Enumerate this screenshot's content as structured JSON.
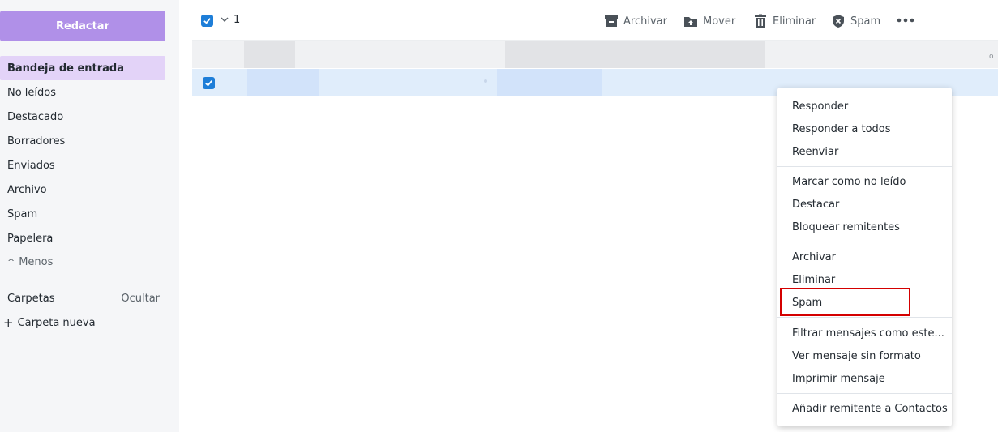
{
  "sidebar": {
    "compose_label": "Redactar",
    "nav": [
      {
        "label": "Bandeja de entrada",
        "active": true
      },
      {
        "label": "No leídos"
      },
      {
        "label": "Destacado"
      },
      {
        "label": "Borradores"
      },
      {
        "label": "Enviados"
      },
      {
        "label": "Archivo"
      },
      {
        "label": "Spam"
      },
      {
        "label": "Papelera"
      }
    ],
    "less_label": "Menos",
    "folders_label": "Carpetas",
    "folders_hide_label": "Ocultar",
    "new_folder_label": "Carpeta nueva"
  },
  "toolbar": {
    "selected_count": "1",
    "archive_label": "Archivar",
    "move_label": "Mover",
    "delete_label": "Eliminar",
    "spam_label": "Spam"
  },
  "list": {
    "row1_indicator": "o"
  },
  "context_menu": {
    "groups": [
      [
        "Responder",
        "Responder a todos",
        "Reenviar"
      ],
      [
        "Marcar como no leído",
        "Destacar",
        "Bloquear remitentes"
      ],
      [
        "Archivar",
        "Eliminar",
        "Spam"
      ],
      [
        "Filtrar mensajes como este...",
        "Ver mensaje sin formato",
        "Imprimir mensaje"
      ],
      [
        "Añadir remitente a Contactos"
      ]
    ],
    "highlighted_item": "Spam"
  },
  "colors": {
    "compose": "#b090e8",
    "active_nav": "#e3d3f8",
    "selected_row": "#e0edfb",
    "checkbox": "#1e7ed8",
    "highlight_box": "#d40000"
  }
}
